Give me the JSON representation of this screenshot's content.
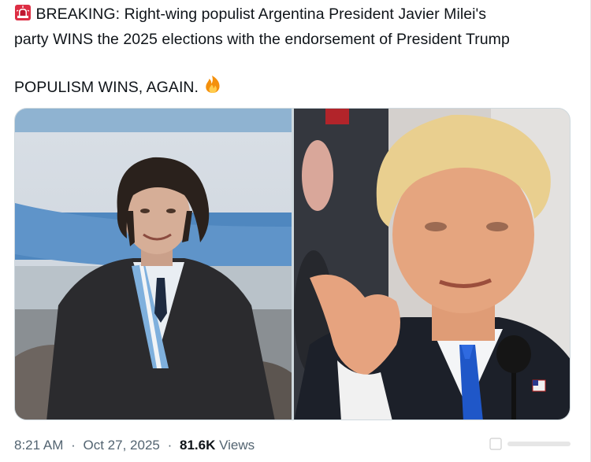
{
  "tweet": {
    "line1": "BREAKING: Right-wing populist Argentina President Javier Milei's",
    "line2": "party WINS the 2025 elections with the endorsement of President Trump",
    "line3": "POPULISM WINS, AGAIN.",
    "siren_emoji": "siren-icon",
    "fire_emoji": "fire-icon"
  },
  "media": {
    "photos": [
      {
        "subject": "milei-photo"
      },
      {
        "subject": "trump-photo"
      }
    ]
  },
  "meta": {
    "time": "8:21 AM",
    "date": "Oct 27, 2025",
    "views_count": "81.6K",
    "views_label": "Views",
    "separator": "·"
  }
}
